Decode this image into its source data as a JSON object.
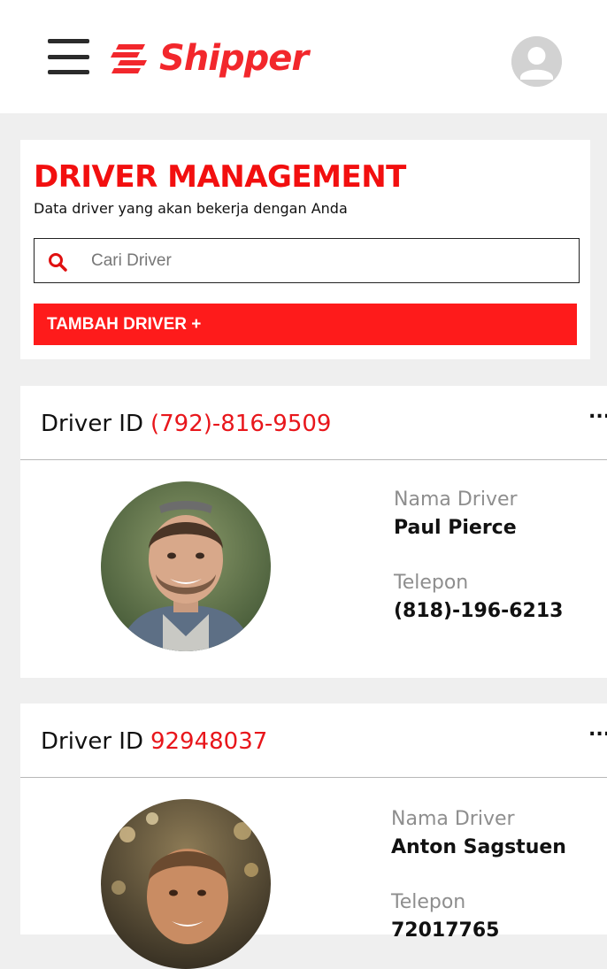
{
  "app": {
    "brand_name": "Shipper",
    "brand_color": "#f2272c",
    "icons": {
      "menu": "hamburger-menu-icon",
      "logo": "shipper-logo-icon",
      "profile": "user-avatar-icon",
      "search": "search-icon",
      "more": "more-options-icon"
    }
  },
  "page": {
    "title": "DRIVER MANAGEMENT",
    "subtitle": "Data driver yang akan bekerja dengan Anda",
    "search_placeholder": "Cari Driver",
    "search_value": "",
    "add_button_label": "TAMBAH DRIVER +",
    "title_color": "#f20f0f",
    "button_color": "#fe1b1b"
  },
  "drivers": [
    {
      "id_label": "Driver ID",
      "id": "(792)-816-9509",
      "more_label": "...",
      "name_label": "Nama Driver",
      "name": "Paul Pierce",
      "phone_label": "Telepon",
      "phone": "(818)-196-6213"
    },
    {
      "id_label": "Driver ID",
      "id": "92948037",
      "more_label": "...",
      "name_label": "Nama Driver",
      "name": "Anton Sagstuen",
      "phone_label": "Telepon",
      "phone": "72017765"
    }
  ]
}
